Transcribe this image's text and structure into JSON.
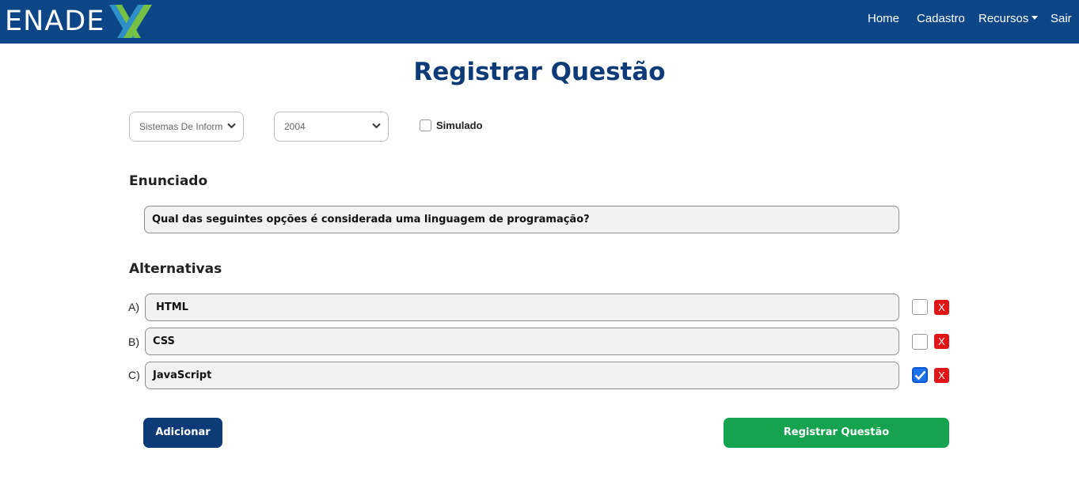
{
  "navbar": {
    "logo_text": "ENADE",
    "logo_letter": "X",
    "links": {
      "home": "Home",
      "cadastro": "Cadastro",
      "recursos": "Recursos",
      "sair": "Sair"
    },
    "bg_color": "#0d4687"
  },
  "page": {
    "title": "Registrar Questão"
  },
  "filters": {
    "course_select": "Sistemas De Informação",
    "course_select_visible": "Sistemas De Inform",
    "year_select": "2004",
    "simulado_label": "Simulado",
    "simulado_checked": false
  },
  "enunciado": {
    "heading": "Enunciado",
    "value": "Qual das seguintes opções é considerada uma linguagem de programação?"
  },
  "alternativas": {
    "heading": "Alternativas",
    "items": [
      {
        "letter": "A)",
        "value": "HTML",
        "correct": false,
        "delete_label": "X"
      },
      {
        "letter": "B)",
        "value": "CSS",
        "correct": false,
        "delete_label": "X"
      },
      {
        "letter": "C)",
        "value": "JavaScript",
        "correct": true,
        "delete_label": "X"
      }
    ]
  },
  "buttons": {
    "add": "Adicionar",
    "submit": "Registrar Questão"
  },
  "colors": {
    "title": "#0d3b78",
    "add_button": "#0d3b78",
    "submit_button": "#15a34f",
    "delete_button": "#e01515",
    "checked": "#1a73e8"
  }
}
